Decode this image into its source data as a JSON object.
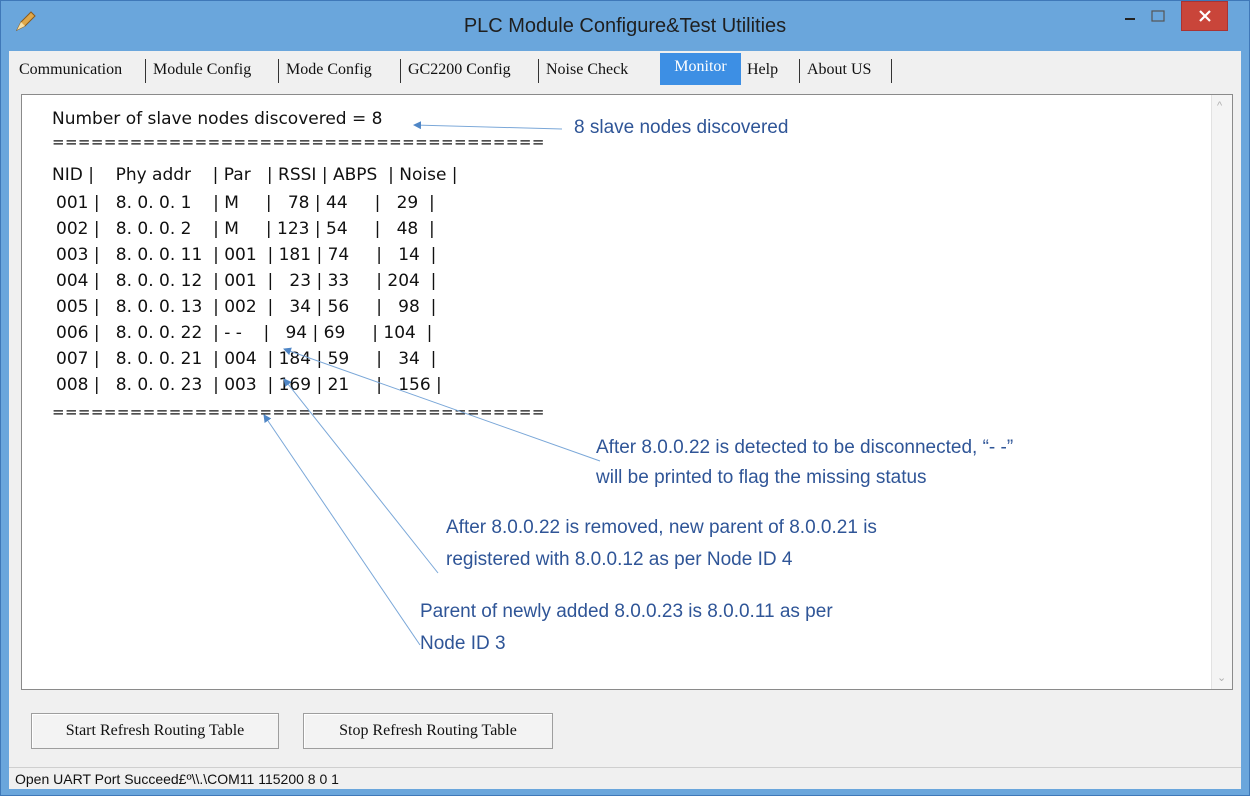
{
  "window": {
    "title": "PLC Module Configure&Test Utilities"
  },
  "tabs": [
    {
      "label": "Communication"
    },
    {
      "label": "Module Config"
    },
    {
      "label": "Mode Config"
    },
    {
      "label": "GC2200 Config"
    },
    {
      "label": "Noise Check"
    },
    {
      "label": "Monitor",
      "active": true
    },
    {
      "label": "Help"
    },
    {
      "label": "About US"
    }
  ],
  "monitor": {
    "discovered_line": "Number of slave nodes discovered = 8",
    "separator": "======================================",
    "header": "NID |    Phy addr    | Par   | RSSI | ABPS  | Noise |",
    "rows": [
      "001 |   8. 0. 0. 1    | M     |   78 | 44     |   29  |",
      "002 |   8. 0. 0. 2    | M     | 123 | 54     |   48  |",
      "003 |   8. 0. 0. 11  | 001  | 181 | 74     |   14  |",
      "004 |   8. 0. 0. 12  | 001  |   23 | 33     | 204  |",
      "005 |   8. 0. 0. 13  | 002  |   34 | 56     |   98  |",
      "006 |   8. 0. 0. 22  | - -    |   94 | 69     | 104  |",
      "007 |   8. 0. 0. 21  | 004  | 184 | 59     |   34  |",
      "008 |   8. 0. 0. 23  | 003  | 169 | 21     |   156 |"
    ]
  },
  "annotations": {
    "a1": "8 slave nodes discovered",
    "a2_line1": "After 8.0.0.22 is detected to be disconnected, “- -”",
    "a2_line2": "will be printed to flag the missing status",
    "a3_line1": "After 8.0.0.22 is removed, new parent of 8.0.0.21 is",
    "a3_line2": "registered with 8.0.0.12 as per Node ID 4",
    "a4_line1": "Parent of newly added 8.0.0.23 is 8.0.0.11 as per",
    "a4_line2": "Node ID 3",
    "color": "#2f5597"
  },
  "buttons": {
    "start": "Start Refresh Routing Table",
    "stop": "Stop Refresh Routing Table"
  },
  "status": {
    "text": "Open UART Port Succeed£º\\\\.\\COM11 115200 8 0 1"
  },
  "colors": {
    "titlebar": "#6aa6dc",
    "tab_active": "#3d8fe4",
    "close": "#c9453a"
  }
}
